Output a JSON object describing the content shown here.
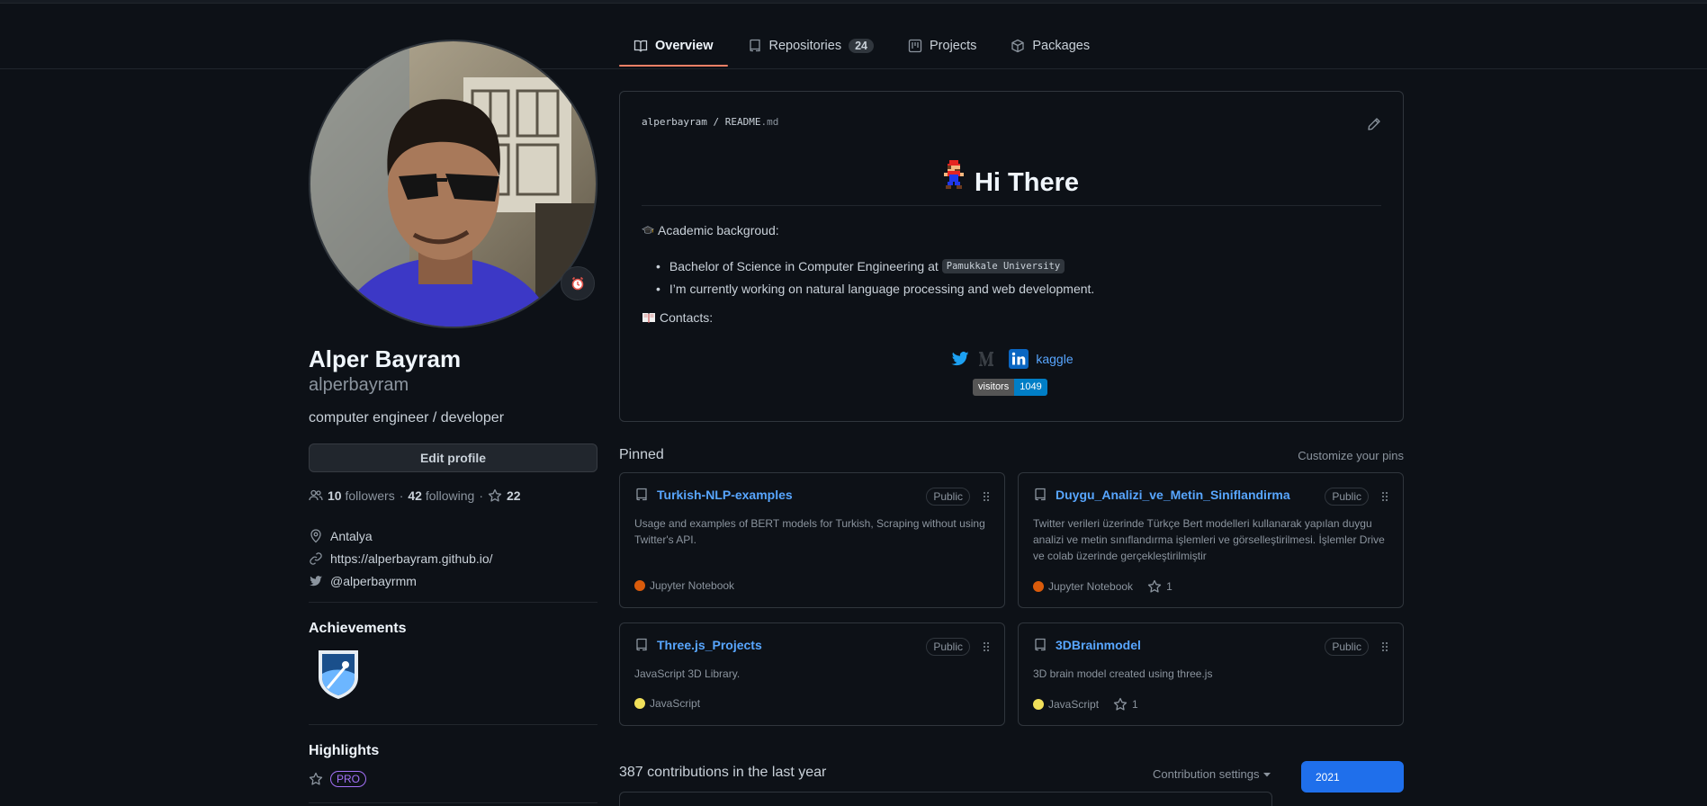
{
  "nav": {
    "tabs": [
      {
        "label": "Overview",
        "icon": "book-icon"
      },
      {
        "label": "Repositories",
        "icon": "repo-icon",
        "count": "24"
      },
      {
        "label": "Projects",
        "icon": "project-icon"
      },
      {
        "label": "Packages",
        "icon": "package-icon"
      }
    ]
  },
  "profile": {
    "name": "Alper Bayram",
    "login": "alperbayram",
    "bio": "computer engineer / developer",
    "edit_label": "Edit profile",
    "followers_count": "10",
    "followers_label": "followers",
    "separator": "·",
    "following_count": "42",
    "following_label": "following",
    "stars_count": "22",
    "location": "Antalya",
    "website": "https://alperbayram.github.io/",
    "twitter": "@alperbayrmm",
    "achievements_title": "Achievements",
    "highlights_title": "Highlights",
    "pro_label": "PRO"
  },
  "readme": {
    "owner": "alperbayram",
    "slash": "/",
    "file": "README",
    "ext": ".md",
    "heading": "Hi There",
    "academic_label": "Academic backgroud:",
    "bullet1_text": "Bachelor of Science in Computer Engineering at",
    "bullet1_code": "Pamukkale University",
    "bullet2_text": "I’m currently working on natural language processing and web development.",
    "contacts_label": "Contacts:",
    "kaggle_label": "kaggle",
    "visitors_label": "visitors",
    "visitors_count": "1049"
  },
  "pinned": {
    "title": "Pinned",
    "customize_label": "Customize your pins",
    "public_label": "Public",
    "cards": [
      {
        "name": "Turkish-NLP-examples",
        "desc": "Usage and examples of BERT models for Turkish, Scraping without using Twitter's API.",
        "lang": "Jupyter Notebook",
        "lang_color": "#DA5B0B",
        "stars": ""
      },
      {
        "name": "Duygu_Analizi_ve_Metin_Siniflandirma",
        "desc": "Twitter verileri üzerinde Türkçe Bert modelleri kullanarak yapılan duygu analizi ve metin sınıflandırma işlemleri ve görselleştirilmesi. İşlemler Drive ve colab üzerinde gerçekleştirilmiştir",
        "lang": "Jupyter Notebook",
        "lang_color": "#DA5B0B",
        "stars": "1"
      },
      {
        "name": "Three.js_Projects",
        "desc": "JavaScript 3D Library.",
        "lang": "JavaScript",
        "lang_color": "#f1e05a",
        "stars": ""
      },
      {
        "name": "3DBrainmodel",
        "desc": "3D brain model created using three.js",
        "lang": "JavaScript",
        "lang_color": "#f1e05a",
        "stars": "1"
      }
    ]
  },
  "contributions": {
    "title": "387 contributions in the last year",
    "settings_label": "Contribution settings",
    "year": "2021"
  }
}
